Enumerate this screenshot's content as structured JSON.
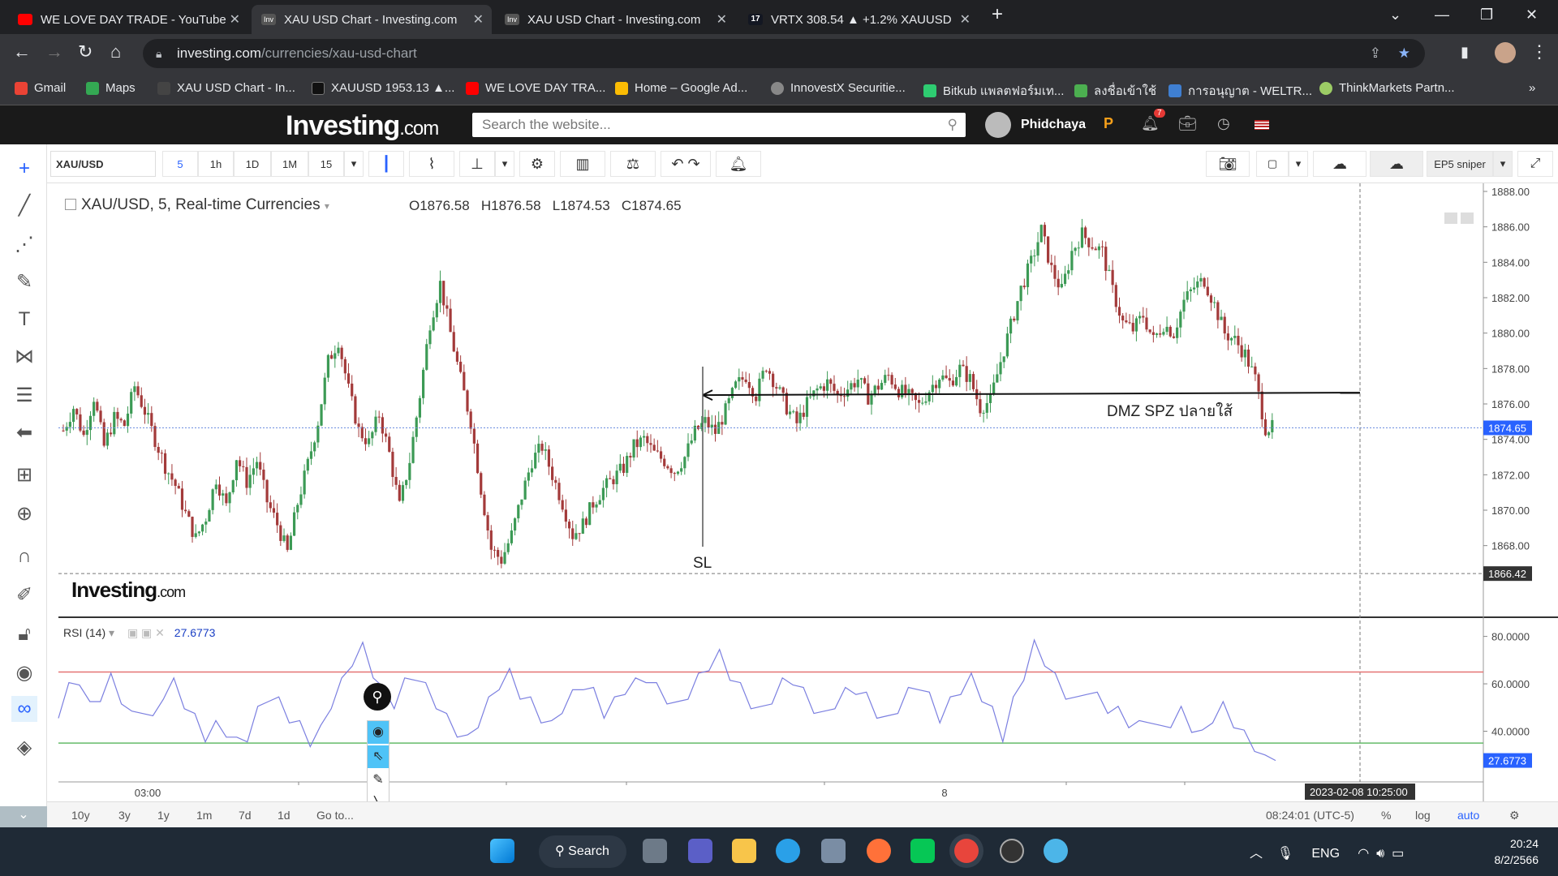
{
  "browser": {
    "tabs": [
      {
        "title": "WE LOVE DAY TRADE - YouTube",
        "icon": "youtube-icon",
        "active": false
      },
      {
        "title": "XAU USD Chart - Investing.com",
        "icon": "investing-icon",
        "active": true
      },
      {
        "title": "XAU USD Chart - Investing.com",
        "icon": "investing-icon",
        "active": false
      },
      {
        "title": "VRTX 308.54 ▲ +1.2% XAUUSD",
        "icon": "tradingview-icon",
        "active": false
      }
    ],
    "url_domain": "investing.com",
    "url_path": "/currencies/xau-usd-chart",
    "bookmarks": [
      {
        "label": "Gmail",
        "color": "#ea4335"
      },
      {
        "label": "Maps",
        "color": "#34a853"
      },
      {
        "label": "XAU USD Chart - In...",
        "color": "#444444"
      },
      {
        "label": "XAUUSD 1953.13 ▲...",
        "color": "#222222"
      },
      {
        "label": "WE LOVE DAY TRA...",
        "color": "#ff0000"
      },
      {
        "label": "Home – Google Ad...",
        "color": "#fbbc04"
      },
      {
        "label": "InnovestX Securitie...",
        "color": "#888888"
      },
      {
        "label": "Bitkub แพลตฟอร์มเท...",
        "color": "#2ecc71"
      },
      {
        "label": "ลงชื่อเข้าใช้",
        "color": "#4caf50"
      },
      {
        "label": "การอนุญาต - WELTR...",
        "color": "#3f7fd1"
      },
      {
        "label": "ThinkMarkets Partn...",
        "color": "#9ccc65"
      }
    ]
  },
  "site": {
    "logo_main": "Investing",
    "logo_suffix": ".com",
    "search_placeholder": "Search the website...",
    "username": "Phidchaya",
    "notif_count": "7"
  },
  "toolbar": {
    "symbol": "XAU/USD",
    "intervals": [
      "5",
      "1h",
      "1D",
      "1M",
      "15"
    ],
    "active_interval": "5",
    "template_label": "EP5 sniper"
  },
  "chart_header": {
    "title": "XAU/USD, 5, Real-time Currencies",
    "open": "O1876.58",
    "high": "H1876.58",
    "low": "L1874.53",
    "close": "C1874.65",
    "watermark_main": "Investing",
    "watermark_suffix": ".com"
  },
  "chart_data": {
    "type": "candlestick",
    "symbol": "XAU/USD",
    "interval": "5",
    "ylim": [
      1864,
      1888
    ],
    "yticks": [
      "1888.00",
      "1886.00",
      "1884.00",
      "1882.00",
      "1880.00",
      "1878.00",
      "1876.00",
      "1874.00",
      "1872.00",
      "1870.00",
      "1868.00",
      "1864.00"
    ],
    "last_price": "1874.65",
    "last_price_value": 1874.65,
    "level_line": "1866.42",
    "level_line_value": 1866.42,
    "xticks": [
      "03:00",
      "8"
    ],
    "crosshair_time": "2023-02-08 10:25:00",
    "price_path": [
      1874.5,
      1875.8,
      1874.2,
      1876.4,
      1873.6,
      1875.2,
      1874.8,
      1877.0,
      1875.6,
      1874.0,
      1872.5,
      1871.4,
      1869.8,
      1868.4,
      1869.6,
      1871.8,
      1870.2,
      1873.0,
      1871.6,
      1872.8,
      1870.5,
      1869.2,
      1867.6,
      1870.4,
      1872.6,
      1875.0,
      1878.4,
      1879.6,
      1876.8,
      1874.5,
      1873.8,
      1875.4,
      1873.2,
      1870.2,
      1872.8,
      1876.5,
      1880.6,
      1882.8,
      1880.0,
      1877.4,
      1875.0,
      1871.2,
      1867.8,
      1867.2,
      1868.6,
      1870.8,
      1872.8,
      1873.6,
      1872.0,
      1870.4,
      1868.6,
      1869.2,
      1870.4,
      1871.2,
      1871.8,
      1872.4,
      1873.6,
      1874.0,
      1873.2,
      1872.8,
      1872.2,
      1873.0,
      1874.4,
      1875.0,
      1874.4,
      1875.6,
      1877.0,
      1877.6,
      1876.5,
      1878.2,
      1877.0,
      1875.8,
      1874.9,
      1876.0,
      1876.8,
      1877.2,
      1876.5,
      1876.9,
      1877.4,
      1876.4,
      1877.0,
      1877.6,
      1876.8,
      1876.4,
      1875.9,
      1876.8,
      1877.6,
      1877.2,
      1878.0,
      1877.4,
      1875.8,
      1876.2,
      1878.4,
      1880.4,
      1882.5,
      1884.0,
      1885.8,
      1883.6,
      1882.4,
      1884.6,
      1885.6,
      1885.0,
      1884.6,
      1882.4,
      1880.6,
      1880.2,
      1881.0,
      1879.6,
      1880.5,
      1880.0,
      1881.8,
      1882.6,
      1883.0,
      1881.6,
      1880.0,
      1879.6,
      1878.8,
      1877.4,
      1874.65
    ],
    "annotations": [
      "DMZ SPZ ปลายใส้",
      "SL"
    ],
    "annotation_level": 1876.5
  },
  "rsi": {
    "label": "RSI (14)",
    "value": "27.6773",
    "value_num": 27.6773,
    "ylim": [
      20,
      85
    ],
    "yticks": [
      "80.0000",
      "60.0000",
      "40.0000"
    ],
    "upper_band": 65,
    "lower_band": 35,
    "upper_color": "#e57373",
    "lower_color": "#66bb6a",
    "line_color": "#7b7fe0",
    "values": [
      48,
      58,
      62,
      50,
      55,
      62,
      54,
      46,
      50,
      44,
      56,
      60,
      52,
      45,
      38,
      42,
      40,
      35,
      38,
      48,
      55,
      52,
      46,
      42,
      36,
      40,
      52,
      60,
      70,
      75,
      65,
      56,
      52,
      60,
      64,
      58,
      52,
      45,
      40,
      36,
      44,
      52,
      60,
      64,
      56,
      52,
      46,
      42,
      50,
      55,
      60,
      56,
      48,
      52,
      58,
      60,
      63,
      58,
      54,
      50,
      56,
      62,
      68,
      72,
      64,
      58,
      52,
      48,
      54,
      60,
      62,
      56,
      50,
      46,
      52,
      56,
      58,
      54,
      48,
      44,
      50,
      56,
      60,
      54,
      46,
      52,
      58,
      62,
      55,
      48,
      38,
      52,
      64,
      76,
      70,
      62,
      56,
      52,
      58,
      54,
      50,
      48,
      44,
      42,
      46,
      40,
      44,
      48,
      42,
      38,
      46,
      50,
      44,
      38,
      34,
      30,
      27.68
    ],
    "crosshair_label": "2023-02-08 10:25:00"
  },
  "ranges": [
    "10y",
    "3y",
    "1y",
    "1m",
    "7d",
    "1d",
    "Go to..."
  ],
  "status": {
    "time": "08:24:01 (UTC-5)",
    "pct": "%",
    "log": "log",
    "auto": "auto"
  },
  "taskbar": {
    "search_label": "Search",
    "lang": "ENG",
    "time": "20:24",
    "date": "8/2/2566"
  }
}
